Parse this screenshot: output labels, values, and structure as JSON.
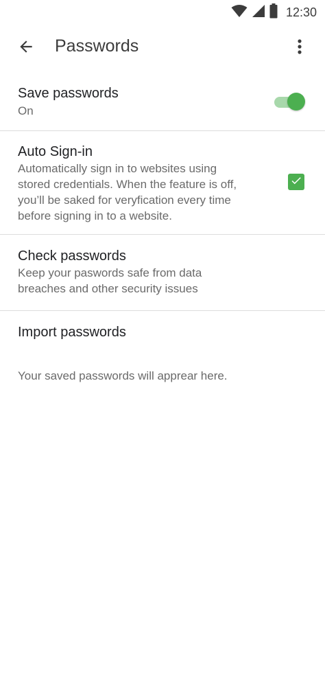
{
  "status_bar": {
    "time": "12:30",
    "icons": [
      "wifi-icon",
      "cell-signal-icon",
      "battery-icon"
    ]
  },
  "app_bar": {
    "title": "Passwords",
    "back_icon": "arrow-back-icon",
    "more_icon": "more-vert-icon"
  },
  "settings": {
    "save_passwords": {
      "title": "Save passwords",
      "status": "On",
      "enabled": true
    },
    "auto_sign_in": {
      "title": "Auto Sign-in",
      "line1": "Automatically sign in to websites using",
      "line2": "stored credentials. When the feature is off,",
      "line3": "you’ll be saked for veryfication every time",
      "line4": "before signing in to a website.",
      "checked": true
    },
    "check_passwords": {
      "title": "Check passwords",
      "line1": "Keep your paswords safe from data",
      "line2": "breaches and other security issues"
    },
    "import_passwords": {
      "title": "Import passwords"
    }
  },
  "empty_message": "Your saved passwords will apprear here.",
  "colors": {
    "accent": "#4caf50",
    "accent_light": "#a8d8ab",
    "divider": "#dcdcdc"
  }
}
